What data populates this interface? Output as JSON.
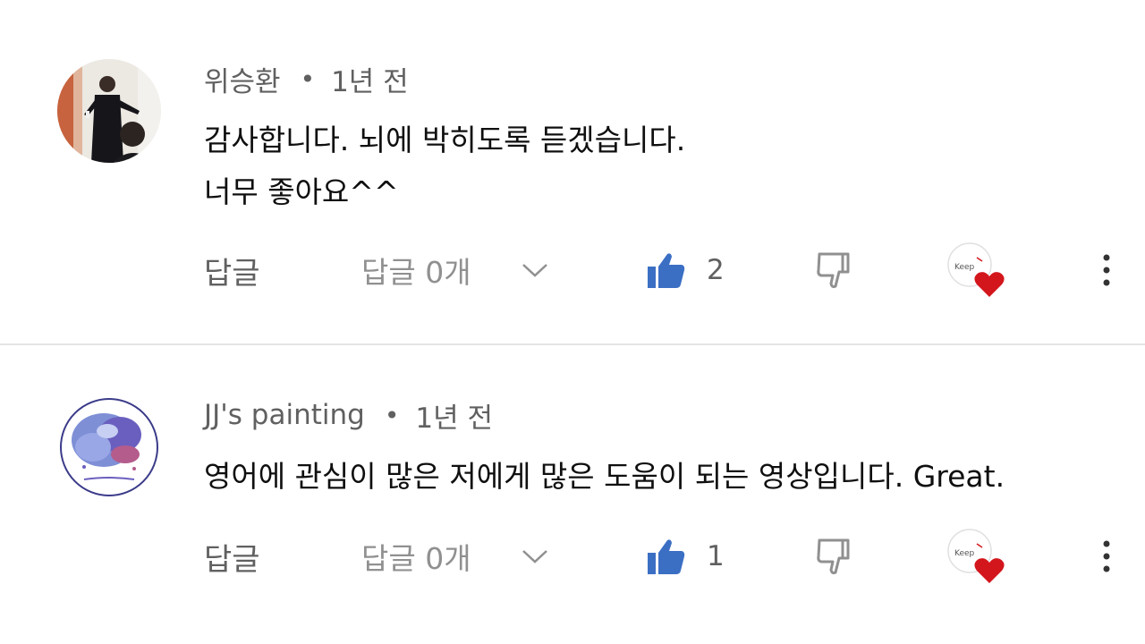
{
  "comments": [
    {
      "author": "위승환",
      "separator": "•",
      "time": "1년 전",
      "lines": [
        "감사합니다. 뇌에 박히도록 듣겠습니다.",
        "너무 좋아요^^"
      ],
      "reply_label": "답글",
      "replies_label": "답글 0개",
      "likes": "2",
      "avatar_icon": "user-avatar-photo",
      "heart_badge_text": "Keep"
    },
    {
      "author": "JJ's painting",
      "separator": "•",
      "time": "1년 전",
      "lines": [
        "영어에 관심이 많은 저에게 많은 도움이 되는 영상입니다. Great."
      ],
      "reply_label": "답글",
      "replies_label": "답글 0개",
      "likes": "1",
      "avatar_icon": "user-avatar-painting",
      "heart_badge_text": "Keep"
    }
  ],
  "colors": {
    "like_blue": "#3b6fc4",
    "secondary_text": "#606060",
    "heart_red": "#d3161c",
    "divider": "#e5e5e5"
  }
}
